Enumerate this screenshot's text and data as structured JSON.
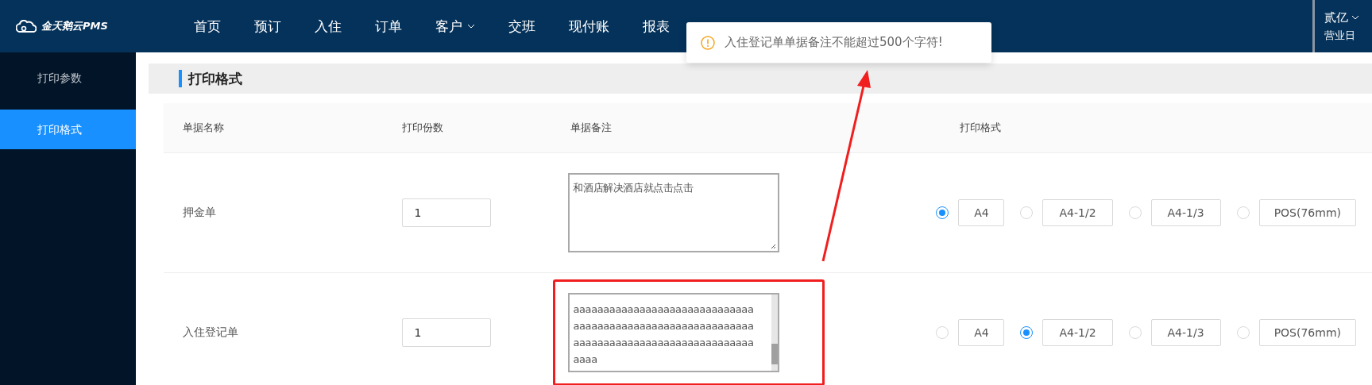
{
  "brand": {
    "name": "金天鹅云PMS"
  },
  "nav": [
    {
      "label": "首页",
      "dropdown": false
    },
    {
      "label": "预订",
      "dropdown": false
    },
    {
      "label": "入住",
      "dropdown": false
    },
    {
      "label": "订单",
      "dropdown": false
    },
    {
      "label": "客户",
      "dropdown": true
    },
    {
      "label": "交班",
      "dropdown": false
    },
    {
      "label": "现付账",
      "dropdown": false
    },
    {
      "label": "报表",
      "dropdown": false
    }
  ],
  "user": {
    "name": "贰亿",
    "business_day_label": "营业日"
  },
  "sidebar": {
    "items": [
      {
        "label": "打印参数",
        "selected": false
      },
      {
        "label": "打印格式",
        "selected": true
      }
    ]
  },
  "section": {
    "title": "打印格式"
  },
  "table": {
    "columns": [
      "单据名称",
      "打印份数",
      "单据备注",
      "打印格式"
    ],
    "rows": [
      {
        "name": "押金单",
        "copies": "1",
        "remark": "和酒店解决酒店就点击点击",
        "scrolled": false,
        "highlighted": false,
        "formats": [
          {
            "label": "A4",
            "selected": true
          },
          {
            "label": "A4-1/2",
            "selected": false
          },
          {
            "label": "A4-1/3",
            "selected": false
          },
          {
            "label": "POS(76mm)",
            "selected": false
          }
        ]
      },
      {
        "name": "入住登记单",
        "copies": "1",
        "remark": "aaaaaaaaaaaaaaaaaaaaaaaaaaaaaa\naaaaaaaaaaaaaaaaaaaaaaaaaaaaaa\naaaaaaaaaaaaaaaaaaaaaaaaaaaaaa\naaaa",
        "scrolled": true,
        "highlighted": true,
        "formats": [
          {
            "label": "A4",
            "selected": false
          },
          {
            "label": "A4-1/2",
            "selected": true
          },
          {
            "label": "A4-1/3",
            "selected": false
          },
          {
            "label": "POS(76mm)",
            "selected": false
          }
        ]
      }
    ]
  },
  "toast": {
    "kind": "warning",
    "message": "入住登记单单据备注不能超过500个字符!"
  }
}
